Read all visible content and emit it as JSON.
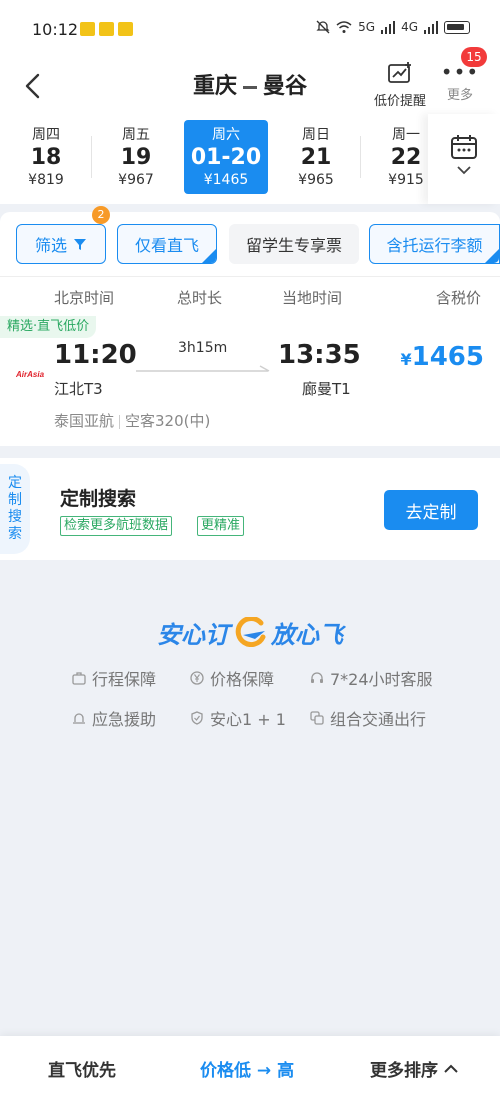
{
  "status": {
    "time": "10:12",
    "net1": "5G",
    "net2": "4G"
  },
  "header": {
    "origin": "重庆",
    "destination": "曼谷",
    "price_alert_label": "低价提醒",
    "more_label": "更多",
    "more_badge": "15"
  },
  "dates": [
    {
      "dow": "周四",
      "day": "18",
      "price": "¥819"
    },
    {
      "dow": "周五",
      "day": "19",
      "price": "¥967"
    },
    {
      "dow": "周六",
      "day": "01-20",
      "price": "¥1465"
    },
    {
      "dow": "周日",
      "day": "21",
      "price": "¥965"
    },
    {
      "dow": "周一",
      "day": "22",
      "price": "¥915"
    }
  ],
  "filters": {
    "filter_label": "筛选",
    "filter_badge": "2",
    "direct_label": "仅看直飞",
    "student_label": "留学生专享票",
    "baggage_label": "含托运行李额"
  },
  "columns": {
    "beijing_time": "北京时间",
    "duration": "总时长",
    "local_time": "当地时间",
    "tax_price": "含税价"
  },
  "flight": {
    "tag": "精选·直飞低价",
    "dep_time": "11:20",
    "arr_time": "13:35",
    "duration": "3h15m",
    "dep_airport": "江北T3",
    "arr_airport": "廊曼T1",
    "price_symbol": "¥",
    "price": "1465",
    "airline": "泰国亚航",
    "aircraft": "空客320(中)",
    "logo_text": "AirAsia"
  },
  "custom": {
    "side_label": "定制搜索",
    "title": "定制搜索",
    "tag1": "检索更多航班数据",
    "tag2": "更精准",
    "button": "去定制"
  },
  "assurance": {
    "left": "安心订",
    "right": "放心飞",
    "features": [
      "行程保障",
      "价格保障",
      "7*24小时客服",
      "应急援助",
      "安心1 + 1",
      "组合交通出行"
    ]
  },
  "sort": {
    "direct_first": "直飞优先",
    "price_low_high": "价格低 → 高",
    "more_sort": "更多排序"
  },
  "colors": {
    "accent": "#1a8cf0",
    "green": "#2aa861",
    "badge": "#f23b3b",
    "orange": "#f79a28"
  }
}
